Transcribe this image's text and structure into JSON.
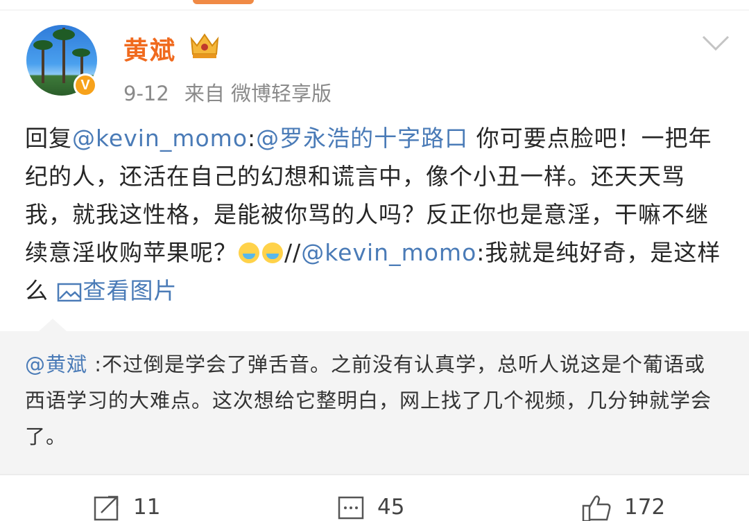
{
  "post": {
    "author": "黄斌",
    "date": "9-12",
    "source": "来自 微博轻享版",
    "content": {
      "prefix": "回复",
      "reply_to": "@kevin_momo",
      "colon1": ":",
      "mention": "@罗永浩的十字路口",
      "body": " 你可要点脸吧！一把年纪的人，还活在自己的幻想和谎言中，像个小丑一样。还天天骂我，就我这性格，是能被你骂的人吗？反正你也是意淫，干嘛不继续意淫收购苹果呢？",
      "slashes": "//",
      "forward_from": "@kevin_momo",
      "forward_text": ":我就是纯好奇，是这样么 ",
      "view_image": "查看图片"
    }
  },
  "retweet": {
    "author_mention": "@黄斌",
    "text": " :不过倒是学会了弹舌音。之前没有认真学，总听人说这是个葡语或西语学习的大难点。这次想给它整明白，网上找了几个视频，几分钟就学会了。"
  },
  "actions": {
    "forward_count": "11",
    "comment_count": "45",
    "like_count": "172"
  },
  "icons": {
    "verified": "verified-v-badge",
    "member": "crown-icon",
    "more": "chevron-down-icon",
    "picture": "picture-icon",
    "forward": "forward-icon",
    "comment": "comment-icon",
    "like": "thumbs-up-icon"
  },
  "colors": {
    "author_name": "#f06a1e",
    "link": "#4a7bb7",
    "meta": "#8a8a8a",
    "retweet_bg": "#f4f4f4"
  }
}
